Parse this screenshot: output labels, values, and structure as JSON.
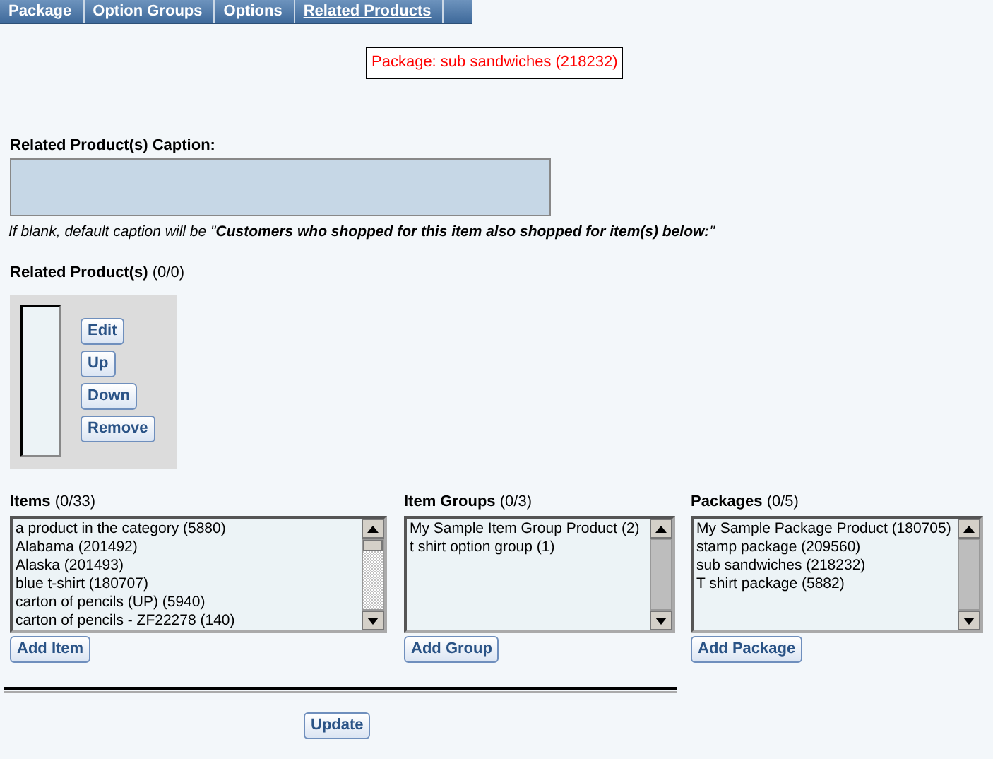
{
  "tabs": [
    {
      "label": "Package",
      "selected": false
    },
    {
      "label": "Option Groups",
      "selected": false
    },
    {
      "label": "Options",
      "selected": false
    },
    {
      "label": "Related Products",
      "selected": true
    }
  ],
  "package_label": "Package: sub sandwiches (218232)",
  "caption": {
    "label": "Related Product(s) Caption:",
    "hint": "If blank, default caption will be \"**Customers who shopped for this item also shopped for item(s) below:**\""
  },
  "related": {
    "label": "Related Product(s)",
    "count": "(0/0)",
    "buttons": [
      "Edit",
      "Up",
      "Down",
      "Remove"
    ]
  },
  "lists": [
    {
      "label": "Items",
      "count": "(0/33)",
      "options": [
        "a product in the category (5880)",
        "Alabama (201492)",
        "Alaska (201493)",
        "blue t-shirt (180707)",
        "carton of pencils (UP) (5940)",
        "carton of pencils - ZF22278 (140)"
      ],
      "button": "Add Item",
      "scrollable": true
    },
    {
      "label": "Item Groups",
      "count": "(0/3)",
      "options": [
        "My Sample Item Group Product (2)",
        "t shirt option group (1)"
      ],
      "button": "Add Group",
      "scrollable": false
    },
    {
      "label": "Packages",
      "count": "(0/5)",
      "options": [
        "My Sample Package Product (180705)",
        "stamp package (209560)",
        "sub sandwiches (218232)",
        "T shirt package (5882)"
      ],
      "button": "Add Package",
      "scrollable": false
    }
  ],
  "update_button": "Update"
}
